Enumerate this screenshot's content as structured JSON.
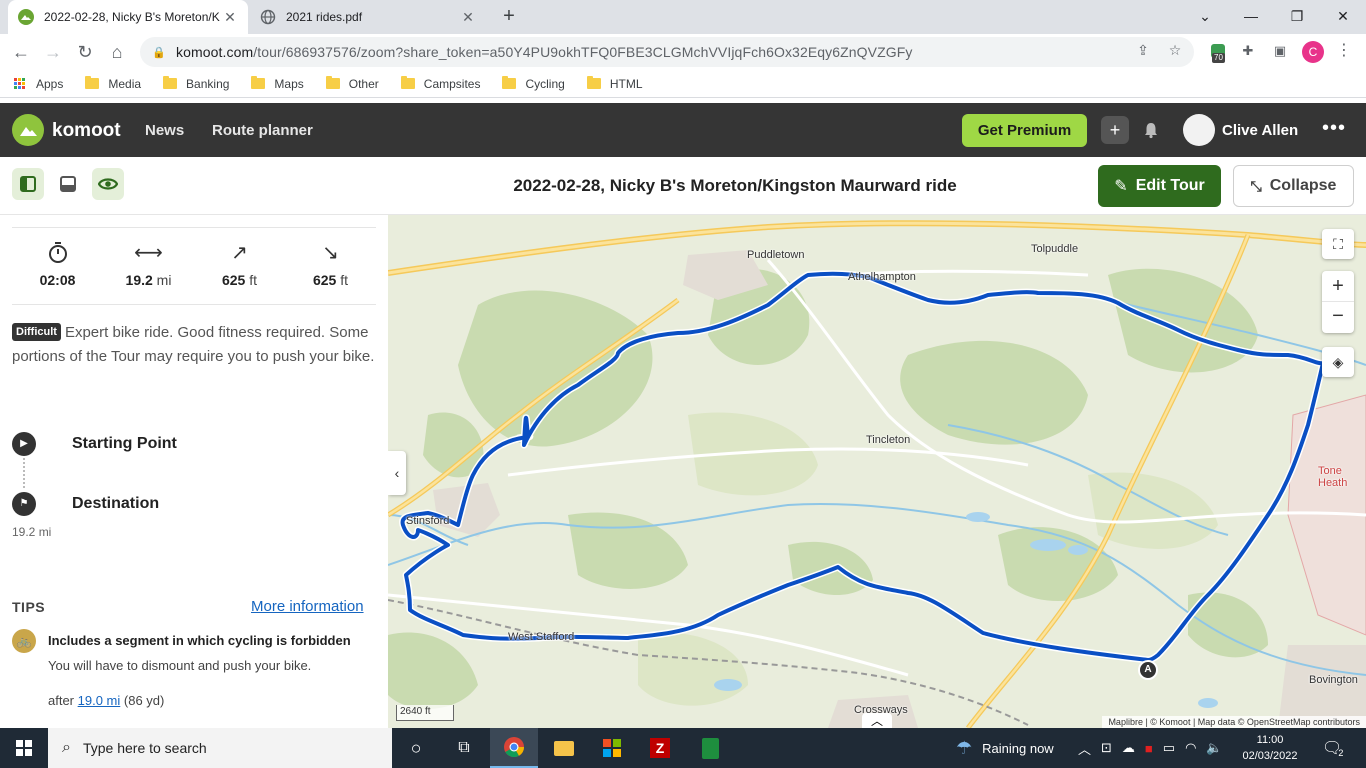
{
  "browser": {
    "tabs": [
      {
        "title": "2022-02-28, Nicky B's Moreton/K",
        "close": "✕"
      },
      {
        "title": "2021 rides.pdf",
        "close": "✕"
      }
    ],
    "new_tab": "+",
    "url_host": "komoot.com",
    "url_path": "/tour/686937576/zoom?share_token=a50Y4PU9okhTFQ0FBE3CLGMchVVIjqFch6Ox32Eqy6ZnQVZGFy",
    "ext_badge": "70",
    "profile_letter": "C",
    "bookmarks": [
      "Apps",
      "Media",
      "Banking",
      "Maps",
      "Other",
      "Campsites",
      "Cycling",
      "HTML"
    ]
  },
  "komoot": {
    "brand": "komoot",
    "nav": [
      "News",
      "Route planner"
    ],
    "premium_label": "Get Premium",
    "user_name": "Clive Allen",
    "more": "•••"
  },
  "tour": {
    "title": "2022-02-28, Nicky B's Moreton/Kingston Maurward ride",
    "edit_label": "Edit Tour",
    "collapse_label": "Collapse"
  },
  "stats": [
    {
      "icon": "timer-icon",
      "value": "02:08",
      "unit": ""
    },
    {
      "icon": "distance-icon",
      "value": "19.2",
      "unit": "mi"
    },
    {
      "icon": "uphill-icon",
      "value": "625",
      "unit": "ft"
    },
    {
      "icon": "downhill-icon",
      "value": "625",
      "unit": "ft"
    }
  ],
  "difficulty": {
    "badge": "Difficult",
    "text": "Expert bike ride. Good fitness required. Some portions of the Tour may require you to push your bike."
  },
  "waypoints": {
    "start": "Starting Point",
    "destination": "Destination",
    "destination_distance": "19.2 mi"
  },
  "tips": {
    "heading": "TIPS",
    "more": "More information",
    "title": "Includes a segment in which cycling is forbidden",
    "desc": "You will have to dismount and push your bike.",
    "after_prefix": "after",
    "after_link": "19.0 mi",
    "after_suffix": "(86 yd)"
  },
  "map": {
    "places": {
      "puddletown": "Puddletown",
      "athelhampton": "Athelhampton",
      "tolpuddle": "Tolpuddle",
      "tincleton": "Tincleton",
      "stinsford": "Stinsford",
      "weststafford": "West Stafford",
      "crossways": "Crossways",
      "bovington": "Bovington",
      "toneheath": "Tone Heath"
    },
    "start_marker": "A",
    "scale": "2640 ft",
    "attribution": "Maplibre | © Komoot | Map data © OpenStreetMap contributors",
    "route_color": "#0a4fc4"
  },
  "taskbar": {
    "search_placeholder": "Type here to search",
    "weather": "Raining now",
    "time": "11:00",
    "date": "02/03/2022",
    "notifications": "2"
  }
}
